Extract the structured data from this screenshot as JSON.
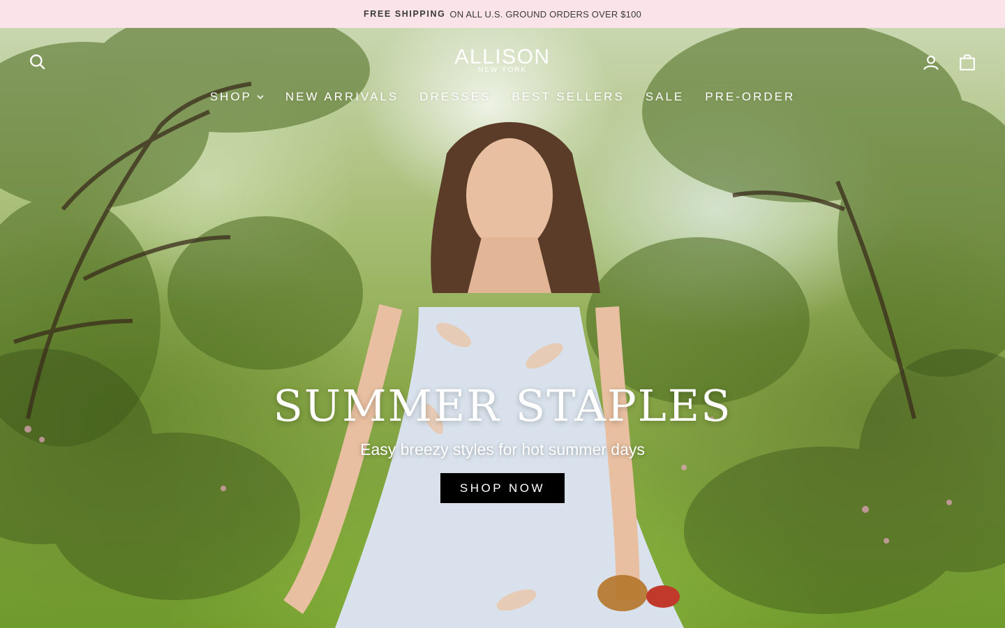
{
  "announcement": {
    "bold": "FREE SHIPPING",
    "text": "ON ALL U.S. GROUND ORDERS OVER $100",
    "background": "#fbe3ea"
  },
  "header": {
    "logo_main": "ALLISON",
    "logo_sub": "NEW YORK",
    "icons": [
      "search-icon",
      "account-icon",
      "cart-icon"
    ]
  },
  "nav": {
    "items": [
      {
        "label": "SHOP",
        "has_dropdown": true
      },
      {
        "label": "NEW ARRIVALS"
      },
      {
        "label": "DRESSES"
      },
      {
        "label": "BEST SELLERS"
      },
      {
        "label": "SALE"
      },
      {
        "label": "PRE-ORDER"
      }
    ]
  },
  "hero": {
    "headline": "SUMMER STAPLES",
    "subheadline": "Easy breezy styles for hot summer days",
    "cta_label": "SHOP NOW"
  }
}
